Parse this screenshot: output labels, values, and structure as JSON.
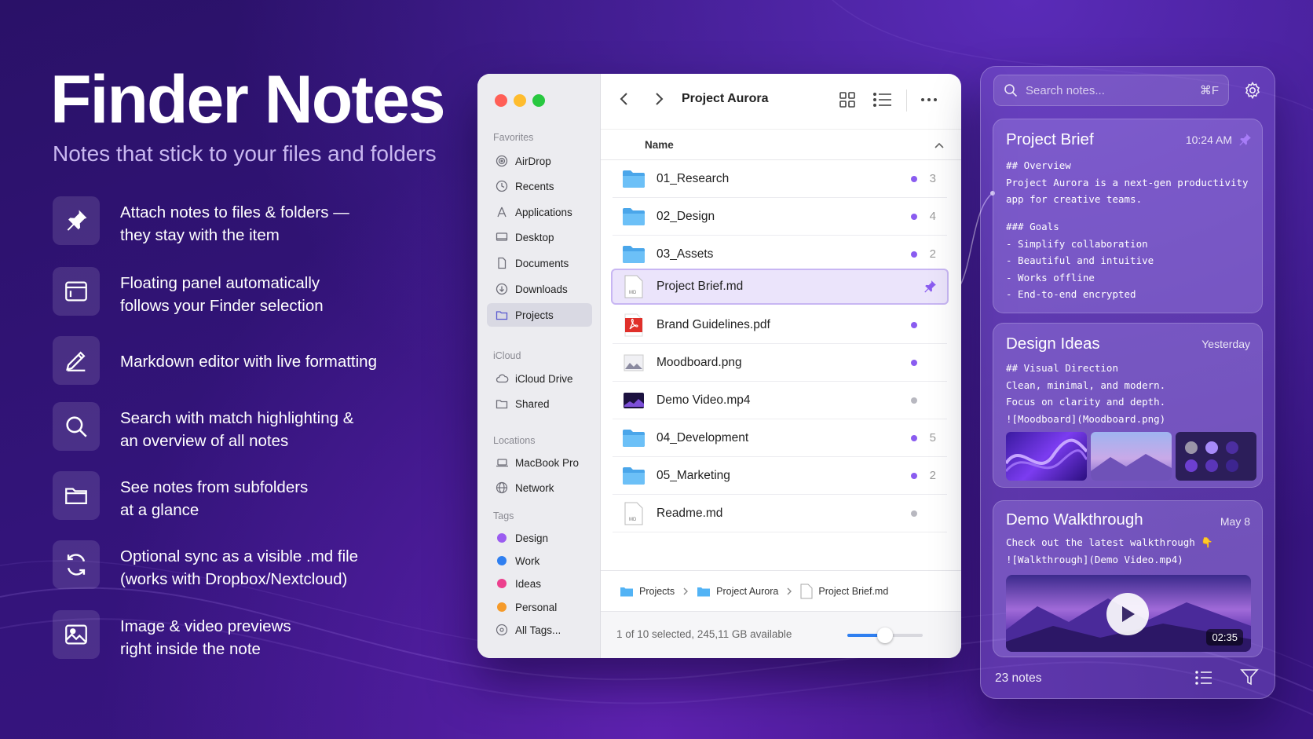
{
  "hero": {
    "title": "Finder Notes",
    "subtitle": "Notes that stick to your files and folders"
  },
  "features": [
    {
      "icon": "pin-icon",
      "text": "Attach notes to files & folders —\nthey stay with the item"
    },
    {
      "icon": "floating-panel-icon",
      "text": "Floating panel automatically\nfollows your Finder selection"
    },
    {
      "icon": "pencil-icon",
      "text": "Markdown editor with live formatting"
    },
    {
      "icon": "search-icon",
      "text": "Search with match highlighting &\nan overview of all notes"
    },
    {
      "icon": "folder-icon",
      "text": "See notes from subfolders\nat a glance"
    },
    {
      "icon": "sync-icon",
      "text": "Optional sync as a visible .md file\n(works with Dropbox/Nextcloud)"
    },
    {
      "icon": "image-icon",
      "text": "Image & video previews\nright inside the note"
    }
  ],
  "finder": {
    "title": "Project Aurora",
    "sidebar": {
      "favorites_label": "Favorites",
      "favorites": [
        {
          "label": "AirDrop",
          "icon": "airdrop-icon"
        },
        {
          "label": "Recents",
          "icon": "clock-icon"
        },
        {
          "label": "Applications",
          "icon": "applications-icon"
        },
        {
          "label": "Desktop",
          "icon": "desktop-icon"
        },
        {
          "label": "Documents",
          "icon": "document-icon"
        },
        {
          "label": "Downloads",
          "icon": "download-icon"
        },
        {
          "label": "Projects",
          "icon": "folder-icon",
          "active": true
        }
      ],
      "icloud_label": "iCloud",
      "icloud": [
        {
          "label": "iCloud Drive",
          "icon": "cloud-icon"
        },
        {
          "label": "Shared",
          "icon": "shared-folder-icon"
        }
      ],
      "locations_label": "Locations",
      "locations": [
        {
          "label": "MacBook Pro",
          "icon": "laptop-icon"
        },
        {
          "label": "Network",
          "icon": "globe-icon"
        }
      ],
      "tags_label": "Tags",
      "tags": [
        {
          "label": "Design",
          "color": "#9b5cf0"
        },
        {
          "label": "Work",
          "color": "#2f7ff0"
        },
        {
          "label": "Ideas",
          "color": "#ec3f8d"
        },
        {
          "label": "Personal",
          "color": "#f59a2a"
        }
      ],
      "all_tags": "All Tags..."
    },
    "column_header": "Name",
    "files": [
      {
        "name": "01_Research",
        "type": "folder",
        "dot": "purple",
        "count": "3"
      },
      {
        "name": "02_Design",
        "type": "folder",
        "dot": "purple",
        "count": "4"
      },
      {
        "name": "03_Assets",
        "type": "folder",
        "dot": "purple",
        "count": "2"
      },
      {
        "name": "Project Brief.md",
        "type": "md",
        "pinned": true,
        "selected": true
      },
      {
        "name": "Brand Guidelines.pdf",
        "type": "pdf",
        "dot": "purple",
        "count": ""
      },
      {
        "name": "Moodboard.png",
        "type": "image",
        "dot": "purple",
        "count": ""
      },
      {
        "name": "Demo Video.mp4",
        "type": "video",
        "dot": "grey",
        "count": ""
      },
      {
        "name": "04_Development",
        "type": "folder",
        "dot": "purple",
        "count": "5"
      },
      {
        "name": "05_Marketing",
        "type": "folder",
        "dot": "purple",
        "count": "2"
      },
      {
        "name": "Readme.md",
        "type": "md",
        "dot": "grey",
        "count": ""
      }
    ],
    "path": [
      "Projects",
      "Project Aurora",
      "Project Brief.md"
    ],
    "status": "1 of 10 selected, 245,11 GB available",
    "zoom_level": 0.5
  },
  "notes_panel": {
    "search_placeholder": "Search notes...",
    "search_shortcut": "⌘F",
    "cards": [
      {
        "title": "Project Brief",
        "time": "10:24 AM",
        "body": "## Overview\nProject Aurora is a next-gen productivity\napp for creative teams.",
        "body2": "### Goals\n- Simplify collaboration\n- Beautiful and intuitive\n- Works offline\n- End-to-end encrypted"
      },
      {
        "title": "Design Ideas",
        "time": "Yesterday",
        "body": "## Visual Direction\nClean, minimal, and modern.\nFocus on clarity and depth.\n![Moodboard](Moodboard.png)"
      },
      {
        "title": "Demo Walkthrough",
        "time": "May 8",
        "body": "Check out the latest walkthrough 👇\n![Walkthrough](Demo Video.mp4)",
        "video_duration": "02:35"
      }
    ],
    "note_count": "23 notes"
  },
  "colors": {
    "accent": "#8a5cf0",
    "folder": "#52b3f5",
    "pdf": "#e0302a"
  }
}
